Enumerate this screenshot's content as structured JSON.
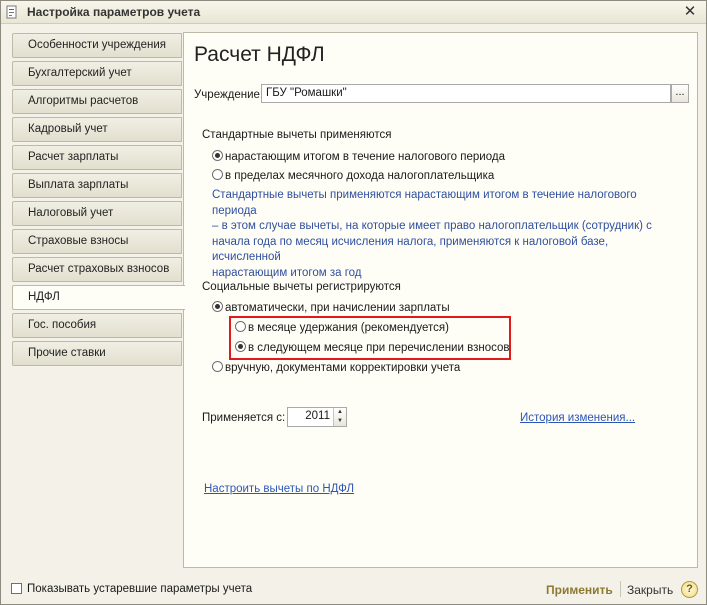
{
  "window": {
    "title": "Настройка параметров учета",
    "close_symbol": "✕"
  },
  "tabs": [
    {
      "label": "Особенности учреждения",
      "active": false
    },
    {
      "label": "Бухгалтерский учет",
      "active": false
    },
    {
      "label": "Алгоритмы расчетов",
      "active": false
    },
    {
      "label": "Кадровый учет",
      "active": false
    },
    {
      "label": "Расчет зарплаты",
      "active": false
    },
    {
      "label": "Выплата зарплаты",
      "active": false
    },
    {
      "label": "Налоговый учет",
      "active": false
    },
    {
      "label": "Страховые взносы",
      "active": false
    },
    {
      "label": "Расчет страховых взносов",
      "active": false
    },
    {
      "label": "НДФЛ",
      "active": true
    },
    {
      "label": "Гос. пособия",
      "active": false
    },
    {
      "label": "Прочие ставки",
      "active": false
    }
  ],
  "panel": {
    "heading": "Расчет НДФЛ",
    "org_label": "Учреждение:",
    "org_value": "ГБУ \"Ромашки\"",
    "org_button": "...",
    "standard": {
      "title": "Стандартные вычеты применяются",
      "option1": "нарастающим итогом в течение налогового периода",
      "option2": "в пределах месячного дохода налогоплательщика",
      "info_line1": "Стандартные вычеты применяются нарастающим итогом в течение налогового периода",
      "info_line2": "– в этом случае вычеты, на которые имеет право налогоплательщик (сотрудник) с",
      "info_line3": "начала года по месяц исчисления налога, применяются к налоговой базе, исчисленной",
      "info_line4": "нарастающим итогом за год"
    },
    "social": {
      "title": "Социальные вычеты регистрируются",
      "option_auto": "автоматически, при начислении зарплаты",
      "sub_option1": "в месяце удержания (рекомендуется)",
      "sub_option2": "в следующем месяце при перечислении взносов",
      "option_manual": "вручную, документами корректировки учета"
    },
    "applies_label": "Применяется с:",
    "applies_year": "2011",
    "history_link": "История изменения...",
    "configure_link": "Настроить вычеты по НДФЛ"
  },
  "footer": {
    "show_obsolete_label": "Показывать устаревшие параметры учета",
    "show_obsolete_checked": false,
    "apply_label": "Применить",
    "close_label": "Закрыть",
    "help_label": "?"
  },
  "colors": {
    "accent_link": "#2b56b5",
    "info_text": "#2f4f9f",
    "highlight_border": "#e0191b",
    "apply_text": "#8c7a32"
  }
}
